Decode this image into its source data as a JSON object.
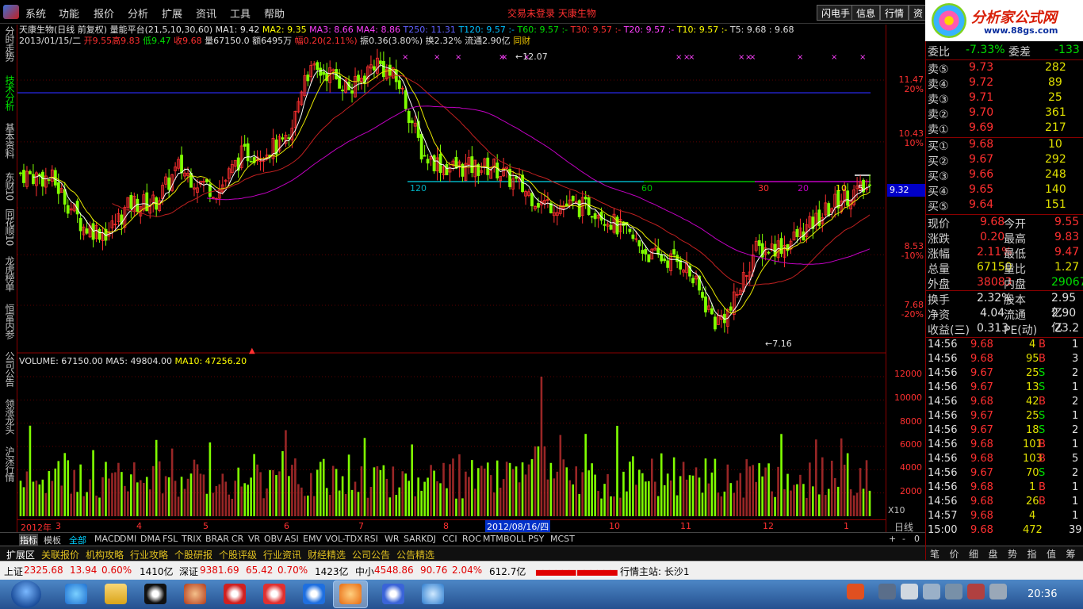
{
  "menu": {
    "items": [
      "系统",
      "功能",
      "报价",
      "分析",
      "扩展",
      "资讯",
      "工具",
      "帮助"
    ],
    "notice": "交易未登录  天康生物",
    "right_buttons": [
      "闪电手",
      "信息",
      "行情",
      "资"
    ]
  },
  "brand": {
    "name": "分析家公式网",
    "url": "www.88gs.com"
  },
  "left_tabs": [
    "分时走势",
    "技术分析",
    "基本资料",
    "东财10",
    "同花顺10",
    "龙虎榜单",
    "恒富内参",
    "公司公告",
    "领涨龙头",
    "沪深行情"
  ],
  "chart": {
    "header": {
      "stock": "天康生物(日线 前复权) 量能平台(21,5,10,30,60)",
      "ma1": "MA1: 9.42",
      "ma2": "MA2: 9.35",
      "ma3": "MA3: 8.66",
      "ma4": "MA4: 8.86",
      "t250": "T250: 11.31",
      "t120": "T120: 9.57 :-",
      "t60": "T60: 9.57 :-",
      "t30": "T30: 9.57 :-",
      "t20": "T20: 9.57 :-",
      "t10": "T10: 9.57 :-",
      "t5": "T5: 9.68 : 9.68"
    },
    "info": {
      "date": "2013/01/15/二",
      "open": "开9.55",
      "high": "高9.83",
      "low": "低9.47",
      "close": "收9.68",
      "vol": "量67150.0",
      "amt": "额6495万",
      "chg": "幅0.20(2.11%)",
      "amp": "振0.36(3.80%)",
      "turn": "换2.32%",
      "float": "流通2.90亿",
      "same": "同财"
    },
    "annotations": {
      "high_mark": "12.07",
      "low_mark": "7.16",
      "lvl120": "120",
      "lvl60": "60",
      "lvl30": "30",
      "lvl20": "20",
      "lvl10": "10",
      "lvl5": "5"
    },
    "price_axis": [
      "11.47",
      "20%",
      "10.43",
      "10%",
      "9.32",
      "8.53",
      "-10%",
      "7.68",
      "-20%"
    ],
    "vol_header": {
      "vol": "VOLUME: 67150.00",
      "ma5": "MA5: 49804.00",
      "ma10": "MA10: 47256.20"
    },
    "vol_axis": [
      "12000",
      "10000",
      "8000",
      "6000",
      "4000",
      "2000"
    ],
    "x10": "X10",
    "dates": [
      "2012年",
      "3",
      "4",
      "5",
      "6",
      "7",
      "8",
      "2012/08/16/四",
      "10",
      "11",
      "12",
      "1"
    ],
    "daily": "日线"
  },
  "indicators": [
    "指标",
    "模板",
    "全部",
    "MACD",
    "DMI",
    "DMA",
    "FSL",
    "TRIX",
    "BRAR",
    "CR",
    "VR",
    "OBV",
    "ASI",
    "EMV",
    "VOL-TDX",
    "RSI",
    "WR",
    "SAR",
    "KDJ",
    "CCI",
    "ROC",
    "MTM",
    "BOLL",
    "PSY",
    "MCST"
  ],
  "func_tabs": [
    "扩展区",
    "关联报价",
    "机构攻略",
    "行业攻略",
    "个股研报",
    "个股评级",
    "行业资讯",
    "财经精选",
    "公司公告",
    "公告精选"
  ],
  "status": {
    "sh_label": "上证",
    "sh_val": "2325.68",
    "sh_chg": "13.94",
    "sh_pct": "0.60%",
    "sh_amt": "1410亿",
    "sz_label": "深证",
    "sz_val": "9381.69",
    "sz_chg": "65.42",
    "sz_pct": "0.70%",
    "sz_amt": "1423亿",
    "zx_label": "中小",
    "zx_val": "4548.86",
    "zx_chg": "90.76",
    "zx_pct": "2.04%",
    "zx_amt": "612.7亿",
    "server": "行情主站: 长沙1"
  },
  "quote": {
    "weibi_label": "委比",
    "weibi": "-7.33%",
    "weicha_label": "委差",
    "weicha": "-133",
    "sells": [
      {
        "label": "卖⑤",
        "price": "9.73",
        "vol": "282"
      },
      {
        "label": "卖④",
        "price": "9.72",
        "vol": "89"
      },
      {
        "label": "卖③",
        "price": "9.71",
        "vol": "25"
      },
      {
        "label": "卖②",
        "price": "9.70",
        "vol": "361"
      },
      {
        "label": "卖①",
        "price": "9.69",
        "vol": "217"
      }
    ],
    "buys": [
      {
        "label": "买①",
        "price": "9.68",
        "vol": "10"
      },
      {
        "label": "买②",
        "price": "9.67",
        "vol": "292"
      },
      {
        "label": "买③",
        "price": "9.66",
        "vol": "248"
      },
      {
        "label": "买④",
        "price": "9.65",
        "vol": "140"
      },
      {
        "label": "买⑤",
        "price": "9.64",
        "vol": "151"
      }
    ],
    "stats": [
      {
        "l1": "现价",
        "v1": "9.68",
        "l2": "今开",
        "v2": "9.55"
      },
      {
        "l1": "涨跌",
        "v1": "0.20",
        "l2": "最高",
        "v2": "9.83"
      },
      {
        "l1": "涨幅",
        "v1": "2.11%",
        "l2": "最低",
        "v2": "9.47"
      },
      {
        "l1": "总量",
        "v1": "67150",
        "l2": "量比",
        "v2": "1.27"
      },
      {
        "l1": "外盘",
        "v1": "38083",
        "l2": "内盘",
        "v2": "29067"
      }
    ],
    "stats2": [
      {
        "l1": "换手",
        "v1": "2.32%",
        "l2": "股本",
        "v2": "2.95亿"
      },
      {
        "l1": "净资",
        "v1": "4.04",
        "l2": "流通",
        "v2": "2.90亿"
      },
      {
        "l1": "收益(三)",
        "v1": "0.313",
        "l2": "PE(动)",
        "v2": "23.2"
      }
    ],
    "ticks": [
      {
        "t": "14:56",
        "p": "9.68",
        "v": "4",
        "d": "B",
        "n": "1"
      },
      {
        "t": "14:56",
        "p": "9.68",
        "v": "95",
        "d": "B",
        "n": "3"
      },
      {
        "t": "14:56",
        "p": "9.67",
        "v": "25",
        "d": "S",
        "n": "2"
      },
      {
        "t": "14:56",
        "p": "9.67",
        "v": "13",
        "d": "S",
        "n": "1"
      },
      {
        "t": "14:56",
        "p": "9.68",
        "v": "42",
        "d": "B",
        "n": "2"
      },
      {
        "t": "14:56",
        "p": "9.67",
        "v": "25",
        "d": "S",
        "n": "1"
      },
      {
        "t": "14:56",
        "p": "9.67",
        "v": "18",
        "d": "S",
        "n": "2"
      },
      {
        "t": "14:56",
        "p": "9.68",
        "v": "101",
        "d": "B",
        "n": "1"
      },
      {
        "t": "14:56",
        "p": "9.68",
        "v": "103",
        "d": "B",
        "n": "5"
      },
      {
        "t": "14:56",
        "p": "9.67",
        "v": "70",
        "d": "S",
        "n": "2"
      },
      {
        "t": "14:56",
        "p": "9.68",
        "v": "1",
        "d": "B",
        "n": "1"
      },
      {
        "t": "14:56",
        "p": "9.68",
        "v": "26",
        "d": "B",
        "n": "1"
      },
      {
        "t": "14:57",
        "p": "9.68",
        "v": "4",
        "d": "",
        "n": "1"
      },
      {
        "t": "15:00",
        "p": "9.68",
        "v": "472",
        "d": "",
        "n": "39"
      }
    ],
    "tabs": [
      "笔",
      "价",
      "细",
      "盘",
      "势",
      "指",
      "值",
      "筹"
    ]
  },
  "taskbar": {
    "clock": "20:36"
  },
  "colors": {
    "up": "#ff3030",
    "down": "#80ff00",
    "bg": "#000000",
    "frame": "#8b0000"
  }
}
